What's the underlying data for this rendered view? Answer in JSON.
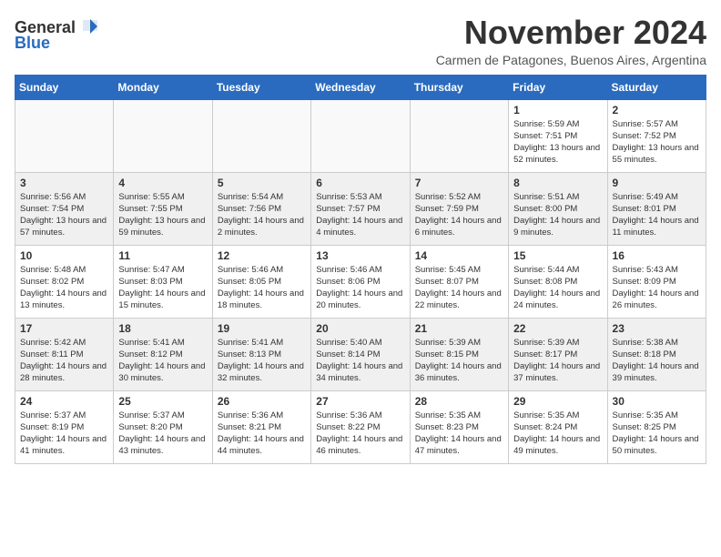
{
  "header": {
    "logo_general": "General",
    "logo_blue": "Blue",
    "month_title": "November 2024",
    "subtitle": "Carmen de Patagones, Buenos Aires, Argentina"
  },
  "weekdays": [
    "Sunday",
    "Monday",
    "Tuesday",
    "Wednesday",
    "Thursday",
    "Friday",
    "Saturday"
  ],
  "weeks": [
    [
      {
        "day": "",
        "empty": true
      },
      {
        "day": "",
        "empty": true
      },
      {
        "day": "",
        "empty": true
      },
      {
        "day": "",
        "empty": true
      },
      {
        "day": "",
        "empty": true
      },
      {
        "day": "1",
        "sunrise": "5:59 AM",
        "sunset": "7:51 PM",
        "daylight": "13 hours and 52 minutes."
      },
      {
        "day": "2",
        "sunrise": "5:57 AM",
        "sunset": "7:52 PM",
        "daylight": "13 hours and 55 minutes."
      }
    ],
    [
      {
        "day": "3",
        "sunrise": "5:56 AM",
        "sunset": "7:54 PM",
        "daylight": "13 hours and 57 minutes."
      },
      {
        "day": "4",
        "sunrise": "5:55 AM",
        "sunset": "7:55 PM",
        "daylight": "13 hours and 59 minutes."
      },
      {
        "day": "5",
        "sunrise": "5:54 AM",
        "sunset": "7:56 PM",
        "daylight": "14 hours and 2 minutes."
      },
      {
        "day": "6",
        "sunrise": "5:53 AM",
        "sunset": "7:57 PM",
        "daylight": "14 hours and 4 minutes."
      },
      {
        "day": "7",
        "sunrise": "5:52 AM",
        "sunset": "7:59 PM",
        "daylight": "14 hours and 6 minutes."
      },
      {
        "day": "8",
        "sunrise": "5:51 AM",
        "sunset": "8:00 PM",
        "daylight": "14 hours and 9 minutes."
      },
      {
        "day": "9",
        "sunrise": "5:49 AM",
        "sunset": "8:01 PM",
        "daylight": "14 hours and 11 minutes."
      }
    ],
    [
      {
        "day": "10",
        "sunrise": "5:48 AM",
        "sunset": "8:02 PM",
        "daylight": "14 hours and 13 minutes."
      },
      {
        "day": "11",
        "sunrise": "5:47 AM",
        "sunset": "8:03 PM",
        "daylight": "14 hours and 15 minutes."
      },
      {
        "day": "12",
        "sunrise": "5:46 AM",
        "sunset": "8:05 PM",
        "daylight": "14 hours and 18 minutes."
      },
      {
        "day": "13",
        "sunrise": "5:46 AM",
        "sunset": "8:06 PM",
        "daylight": "14 hours and 20 minutes."
      },
      {
        "day": "14",
        "sunrise": "5:45 AM",
        "sunset": "8:07 PM",
        "daylight": "14 hours and 22 minutes."
      },
      {
        "day": "15",
        "sunrise": "5:44 AM",
        "sunset": "8:08 PM",
        "daylight": "14 hours and 24 minutes."
      },
      {
        "day": "16",
        "sunrise": "5:43 AM",
        "sunset": "8:09 PM",
        "daylight": "14 hours and 26 minutes."
      }
    ],
    [
      {
        "day": "17",
        "sunrise": "5:42 AM",
        "sunset": "8:11 PM",
        "daylight": "14 hours and 28 minutes."
      },
      {
        "day": "18",
        "sunrise": "5:41 AM",
        "sunset": "8:12 PM",
        "daylight": "14 hours and 30 minutes."
      },
      {
        "day": "19",
        "sunrise": "5:41 AM",
        "sunset": "8:13 PM",
        "daylight": "14 hours and 32 minutes."
      },
      {
        "day": "20",
        "sunrise": "5:40 AM",
        "sunset": "8:14 PM",
        "daylight": "14 hours and 34 minutes."
      },
      {
        "day": "21",
        "sunrise": "5:39 AM",
        "sunset": "8:15 PM",
        "daylight": "14 hours and 36 minutes."
      },
      {
        "day": "22",
        "sunrise": "5:39 AM",
        "sunset": "8:17 PM",
        "daylight": "14 hours and 37 minutes."
      },
      {
        "day": "23",
        "sunrise": "5:38 AM",
        "sunset": "8:18 PM",
        "daylight": "14 hours and 39 minutes."
      }
    ],
    [
      {
        "day": "24",
        "sunrise": "5:37 AM",
        "sunset": "8:19 PM",
        "daylight": "14 hours and 41 minutes."
      },
      {
        "day": "25",
        "sunrise": "5:37 AM",
        "sunset": "8:20 PM",
        "daylight": "14 hours and 43 minutes."
      },
      {
        "day": "26",
        "sunrise": "5:36 AM",
        "sunset": "8:21 PM",
        "daylight": "14 hours and 44 minutes."
      },
      {
        "day": "27",
        "sunrise": "5:36 AM",
        "sunset": "8:22 PM",
        "daylight": "14 hours and 46 minutes."
      },
      {
        "day": "28",
        "sunrise": "5:35 AM",
        "sunset": "8:23 PM",
        "daylight": "14 hours and 47 minutes."
      },
      {
        "day": "29",
        "sunrise": "5:35 AM",
        "sunset": "8:24 PM",
        "daylight": "14 hours and 49 minutes."
      },
      {
        "day": "30",
        "sunrise": "5:35 AM",
        "sunset": "8:25 PM",
        "daylight": "14 hours and 50 minutes."
      }
    ]
  ]
}
